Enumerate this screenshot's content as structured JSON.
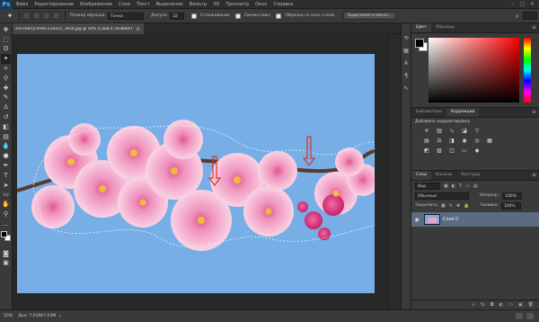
{
  "app": {
    "logo": "Ps"
  },
  "menu": {
    "items": [
      "Файл",
      "Редактирование",
      "Изображение",
      "Слои",
      "Текст",
      "Выделение",
      "Фильтр",
      "3D",
      "Просмотр",
      "Окно",
      "Справка"
    ]
  },
  "options": {
    "brush_size_label": "Размер образца:",
    "brush_size_value": "Точка",
    "tolerance_label": "Допуск:",
    "tolerance_value": "32",
    "smoothing_label": "Сглаживание",
    "contiguous_label": "Смежн.пикс",
    "sample_all_label": "Образец со всех слоев",
    "refine_edge_label": "Выделение и маска..."
  },
  "document": {
    "tab_title": "ere-cherry-trees-124107_1920.jpg @ 50% (Слой 0, RGB/8#) *"
  },
  "status": {
    "zoom": "50%",
    "info": "Док: 7,03M/7,03M"
  },
  "panels": {
    "color_tabs": [
      "Цвет",
      "Образцы"
    ],
    "adjust_tabs": [
      "Библиотеки",
      "Коррекция"
    ],
    "adjust_title": "Добавить корректировку",
    "layers_tabs": [
      "Слои",
      "Каналы",
      "Контуры"
    ],
    "filter_kind": "Вид",
    "blend_mode": "Обычные",
    "opacity_label": "Непрозр.:",
    "opacity_value": "100%",
    "lock_label": "Закрепить:",
    "fill_label": "Заливка:",
    "fill_value": "100%",
    "layer_name": "Слой 0"
  },
  "colors": {
    "sky": "#77aee6",
    "blossom_light": "#f7c3da",
    "blossom_mid": "#ef93bd",
    "blossom_dark": "#e0578f",
    "stamen": "#f0b940",
    "arrow": "#d8332e",
    "layer_selected": "#5a6b82"
  }
}
